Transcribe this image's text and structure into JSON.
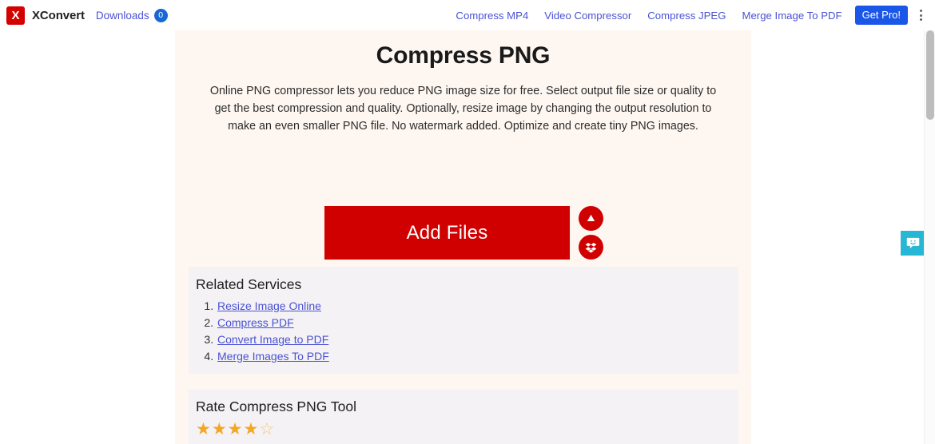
{
  "header": {
    "logo_letter": "X",
    "brand_name": "XConvert",
    "downloads_label": "Downloads",
    "downloads_count": "0",
    "nav_links": [
      {
        "label": "Compress MP4"
      },
      {
        "label": "Video Compressor"
      },
      {
        "label": "Compress JPEG"
      },
      {
        "label": "Merge Image To PDF"
      }
    ],
    "get_pro_label": "Get Pro!",
    "menu_icon": "kebab-menu-icon"
  },
  "main": {
    "title": "Compress PNG",
    "description": "Online PNG compressor lets you reduce PNG image size for free. Select output file size or quality to get the best compression and quality. Optionally, resize image by changing the output resolution to make an even smaller PNG file. No watermark added. Optimize and create tiny PNG images.",
    "add_files_label": "Add Files",
    "cloud_buttons": [
      {
        "icon": "google-drive-icon"
      },
      {
        "icon": "dropbox-icon"
      }
    ]
  },
  "related_services": {
    "heading": "Related Services",
    "items": [
      {
        "label": "Resize Image Online"
      },
      {
        "label": "Compress PDF"
      },
      {
        "label": "Convert Image to PDF"
      },
      {
        "label": "Merge Images To PDF"
      }
    ]
  },
  "rating": {
    "heading": "Rate Compress PNG Tool",
    "value": 4,
    "max": 5,
    "filled_glyph": "★",
    "empty_glyph": "☆"
  },
  "feedback": {
    "icon": "feedback-smiley-icon"
  },
  "colors": {
    "brand_red": "#d10000",
    "link_blue": "#4a52d4",
    "button_blue": "#1a56e8",
    "panel_cream": "#fdf6f1",
    "card_gray": "#f4f2f4",
    "star_gold": "#f5a623",
    "feedback_teal": "#26b7d4"
  }
}
